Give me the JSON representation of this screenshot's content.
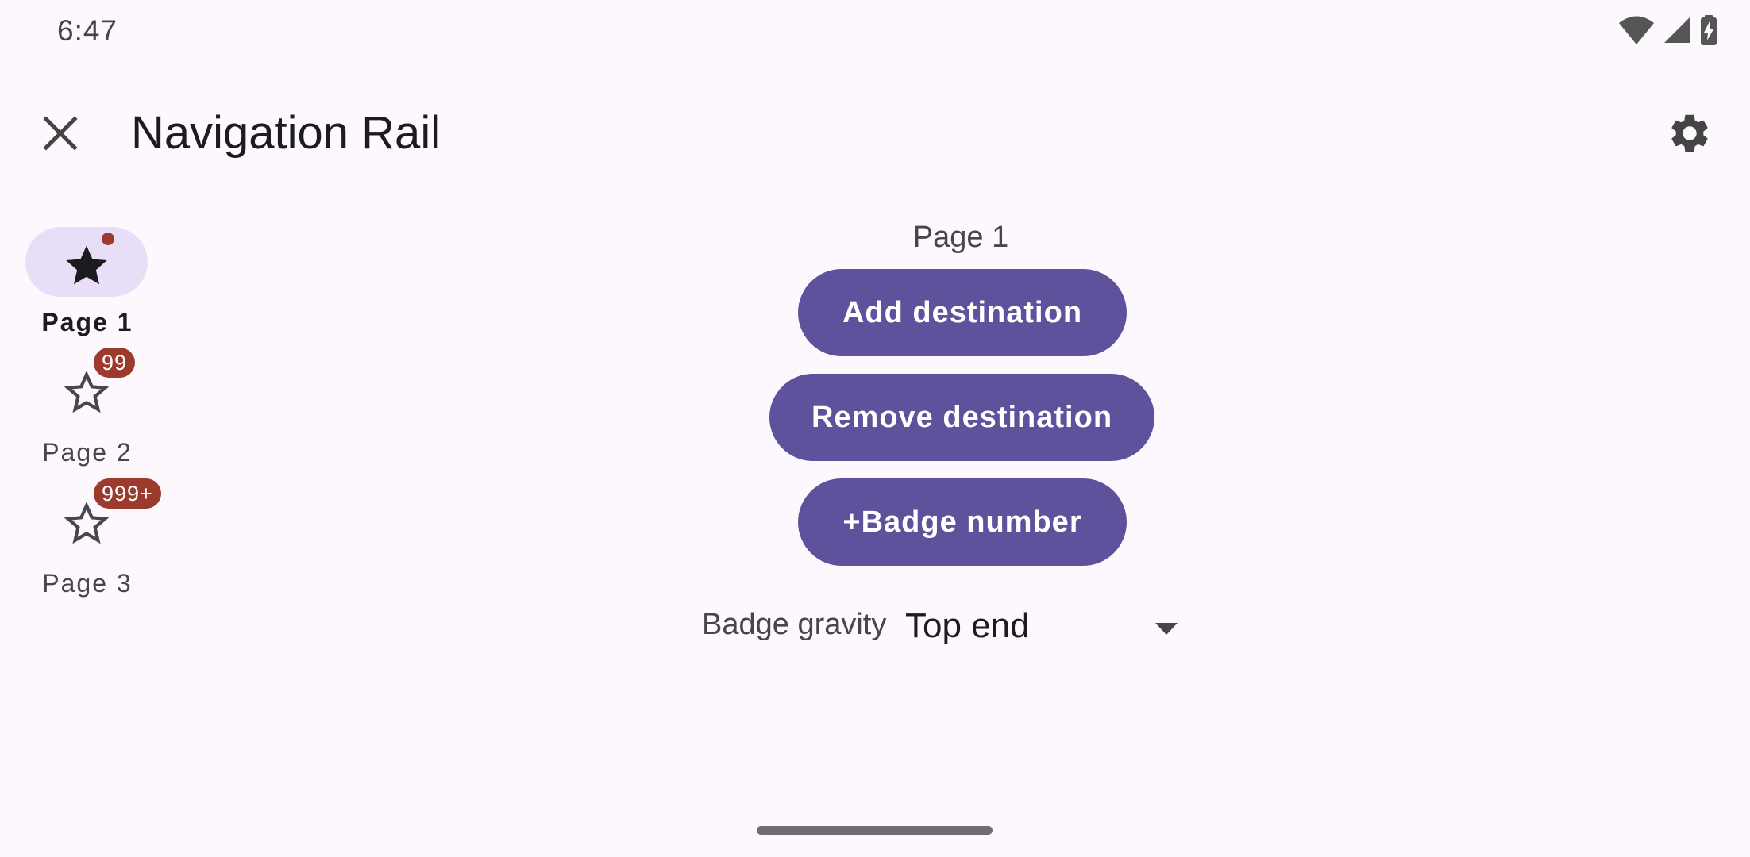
{
  "status_bar": {
    "time": "6:47",
    "icons": [
      "wifi-icon",
      "cellular-signal-icon",
      "battery-charging-icon"
    ]
  },
  "app_bar": {
    "title": "Navigation Rail",
    "close_icon": "close-icon",
    "settings_icon": "settings-icon"
  },
  "rail": {
    "items": [
      {
        "label": "Page 1",
        "icon": "star-filled-icon",
        "selected": true,
        "badge": ""
      },
      {
        "label": "Page 2",
        "icon": "star-outline-icon",
        "selected": false,
        "badge": "99"
      },
      {
        "label": "Page 3",
        "icon": "star-outline-icon",
        "selected": false,
        "badge": "999+"
      }
    ]
  },
  "main": {
    "page_title": "Page 1",
    "add_destination_label": "Add destination",
    "remove_destination_label": "Remove destination",
    "badge_number_label": "+Badge number",
    "badge_gravity": {
      "label": "Badge gravity",
      "value": "Top end"
    }
  },
  "colors": {
    "background": "#FDF8FD",
    "primary_button": "#5E529C",
    "rail_indicator": "#E8DEF8",
    "badge": "#9C3A2E",
    "on_surface": "#1C1B1F",
    "on_surface_variant": "#49454F"
  }
}
